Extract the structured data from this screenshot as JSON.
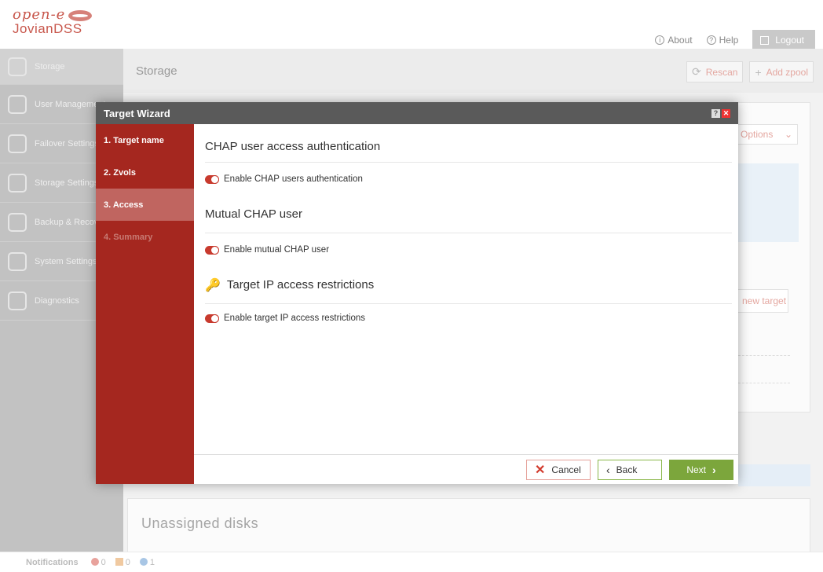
{
  "app": {
    "brand": "open-e",
    "product": "JovianDSS",
    "links": {
      "about": "About",
      "help": "Help",
      "logout": "Logout"
    }
  },
  "sidebar": {
    "items": [
      {
        "label": "Storage",
        "icon": "storage-icon"
      },
      {
        "label": "User Management",
        "icon": "users-icon"
      },
      {
        "label": "Failover Settings",
        "icon": "failover-icon"
      },
      {
        "label": "Storage Settings",
        "icon": "storage-settings-icon"
      },
      {
        "label": "Backup & Recovery",
        "icon": "backup-icon"
      },
      {
        "label": "System Settings",
        "icon": "system-settings-icon"
      },
      {
        "label": "Diagnostics",
        "icon": "diagnostics-icon"
      }
    ]
  },
  "content": {
    "title": "Storage",
    "rescan": "Rescan",
    "add_zpool": "Add zpool",
    "options": "Options",
    "new_target": "new target",
    "unassigned": "Unassigned disks"
  },
  "notifications": {
    "label": "Notifications",
    "errors": "0",
    "warnings": "0",
    "info": "1"
  },
  "wizard": {
    "title": "Target Wizard",
    "steps": [
      {
        "label": "1. Target name",
        "state": "done"
      },
      {
        "label": "2. Zvols",
        "state": "done"
      },
      {
        "label": "3. Access",
        "state": "active"
      },
      {
        "label": "4. Summary",
        "state": "disabled"
      }
    ],
    "sections": {
      "chap_title": "CHAP user access authentication",
      "chap_toggle": "Enable CHAP users authentication",
      "mutual_title": "Mutual CHAP user",
      "mutual_toggle": "Enable mutual CHAP user",
      "ip_title": "Target IP access restrictions",
      "ip_toggle": "Enable target IP access restrictions"
    },
    "buttons": {
      "cancel": "Cancel",
      "back": "Back",
      "next": "Next"
    }
  },
  "colors": {
    "accent": "#a5271f",
    "active_step": "#c06560",
    "toggle": "#c83a2e",
    "next": "#7ca63c"
  }
}
